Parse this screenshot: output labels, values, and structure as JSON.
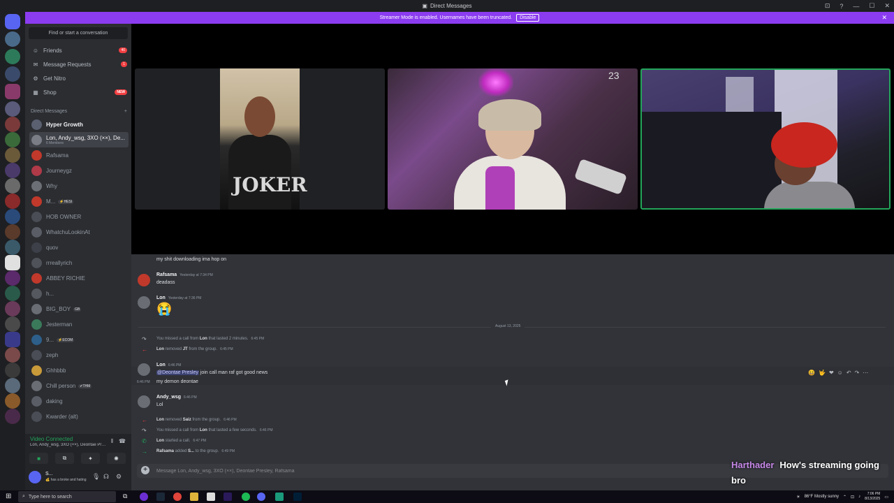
{
  "window": {
    "title": "Direct Messages",
    "controls": [
      "⊡",
      "?",
      "—",
      "☐",
      "✕"
    ]
  },
  "banner": {
    "text": "Streamer Mode is enabled. Usernames have been truncated.",
    "disable_label": "Disable",
    "close": "✕"
  },
  "sidebar": {
    "search_placeholder": "Find or start a conversation",
    "nav": [
      {
        "label": "Friends",
        "icon": "friends-icon",
        "count": "40"
      },
      {
        "label": "Message Requests",
        "icon": "mail-icon",
        "count": "1"
      },
      {
        "label": "Get Nitro",
        "icon": "nitro-icon",
        "count": ""
      },
      {
        "label": "Shop",
        "icon": "shop-icon",
        "badge": "NEW"
      }
    ],
    "dm_header": "Direct Messages",
    "dm_add": "+",
    "dms": [
      {
        "name": "Hyper Growth",
        "sub": "",
        "tag": "",
        "color": "#5a6070"
      },
      {
        "name": "Lon, Andy_wsg, 3XO (××), De...",
        "sub": "6 Members",
        "tag": "",
        "color": "#7a7d85"
      },
      {
        "name": "Rafsama",
        "sub": "",
        "tag": "",
        "color": "#c0392b"
      },
      {
        "name": "Journeygz",
        "sub": "",
        "tag": "",
        "color": "#b03a48"
      },
      {
        "name": "Why",
        "sub": "",
        "tag": "",
        "color": "#6c6f75"
      },
      {
        "name": "M...",
        "sub": "",
        "tag": "⚡HESI",
        "color": "#c0392b"
      },
      {
        "name": "HOB OWNER",
        "sub": "",
        "tag": "",
        "color": "#4a4d55"
      },
      {
        "name": "WhatchuLookinAt",
        "sub": "",
        "tag": "",
        "color": "#5a5d65"
      },
      {
        "name": "quov",
        "sub": "",
        "tag": "",
        "color": "#3d4048"
      },
      {
        "name": "rrreallyrich",
        "sub": "",
        "tag": "",
        "color": "#4f5259"
      },
      {
        "name": "ABBEY RICHIE",
        "sub": "",
        "tag": "",
        "color": "#c0392b"
      },
      {
        "name": "h...",
        "sub": "",
        "tag": "",
        "color": "#55585f"
      },
      {
        "name": "BIG_BOY",
        "sub": "",
        "tag": "GB",
        "color": "#6a6d74"
      },
      {
        "name": "Jesterman",
        "sub": "",
        "tag": "",
        "color": "#3a7a5a"
      },
      {
        "name": "9...",
        "sub": "",
        "tag": "⚡ECOM",
        "color": "#2d5f8a"
      },
      {
        "name": "zeph",
        "sub": "",
        "tag": "",
        "color": "#4a4d55"
      },
      {
        "name": "Ghhbbb",
        "sub": "",
        "tag": "",
        "color": "#c89a3a"
      },
      {
        "name": "Chill person",
        "sub": "",
        "tag": "✔THM",
        "color": "#6a6d74"
      },
      {
        "name": "daking",
        "sub": "",
        "tag": "",
        "color": "#5a5d65"
      },
      {
        "name": "Kwarder (alt)",
        "sub": "",
        "tag": "",
        "color": "#4a4d55"
      }
    ]
  },
  "voice": {
    "status": "Video Connected",
    "channel": "Lon, Andy_wsg, 3XO (××), Deontae Presley,...",
    "buttons": [
      "camera-button",
      "screenshare-button",
      "activity-button",
      "soundboard-button"
    ]
  },
  "user": {
    "name": "S...",
    "status": "💰 has a broke and hating"
  },
  "call": {
    "jersey_number": "23",
    "shirt_text": "JOKER"
  },
  "messages": {
    "top_line": "my shit downloading ima hop on",
    "m1_author": "Rafsama",
    "m1_time": "Yesterday at 7:34 PM",
    "m1_text": "deadass",
    "m2_author": "Lon",
    "m2_time": "Yesterday at 7:36 PM",
    "m2_emoji": "😭",
    "date_divider": "August 13, 2025",
    "sys1": {
      "pre": "You missed a call from ",
      "who": "Lon",
      "post": " that lasted 2 minutes.",
      "time": "6:45 PM"
    },
    "sys2": {
      "who": "Lon",
      "mid": " removed ",
      "target": "JT",
      "post": " from the group.",
      "time": "6:45 PM"
    },
    "m3_author": "Lon",
    "m3_time": "6:46 PM",
    "m3_mention": "@Deontae Presley",
    "m3_text": " join call man raf got good news",
    "m3b_time": "6:46 PM",
    "m3b_text": "my demon deontae",
    "m4_author": "Andy_wsg",
    "m4_time": "6:46 PM",
    "m4_text": "Lol",
    "sys3": {
      "who": "Lon",
      "mid": " removed ",
      "target": "Saiz",
      "post": " from the group.",
      "time": "6:46 PM"
    },
    "sys4": {
      "pre": "You missed a call from ",
      "who": "Lon",
      "post": " that lasted a few seconds.",
      "time": "6:46 PM"
    },
    "sys5": {
      "who": "Lon",
      "post": " started a call.",
      "time": "6:47 PM"
    },
    "sys6": {
      "who": "Rafsama",
      "mid": " added ",
      "target": "S...",
      "post": " to the group.",
      "time": "6:49 PM"
    }
  },
  "composer": {
    "placeholder": "Message Lon, Andy_wsg, 3XO (××), Deontae Presley, Rafsama"
  },
  "overlay_chat": {
    "user": "Harthader",
    "text": "How's streaming going bro"
  },
  "taskbar": {
    "search_placeholder": "Type here to search",
    "weather": "86°F  Mostly sunny",
    "time": "7:06 PM",
    "date": "8/13/2025"
  }
}
